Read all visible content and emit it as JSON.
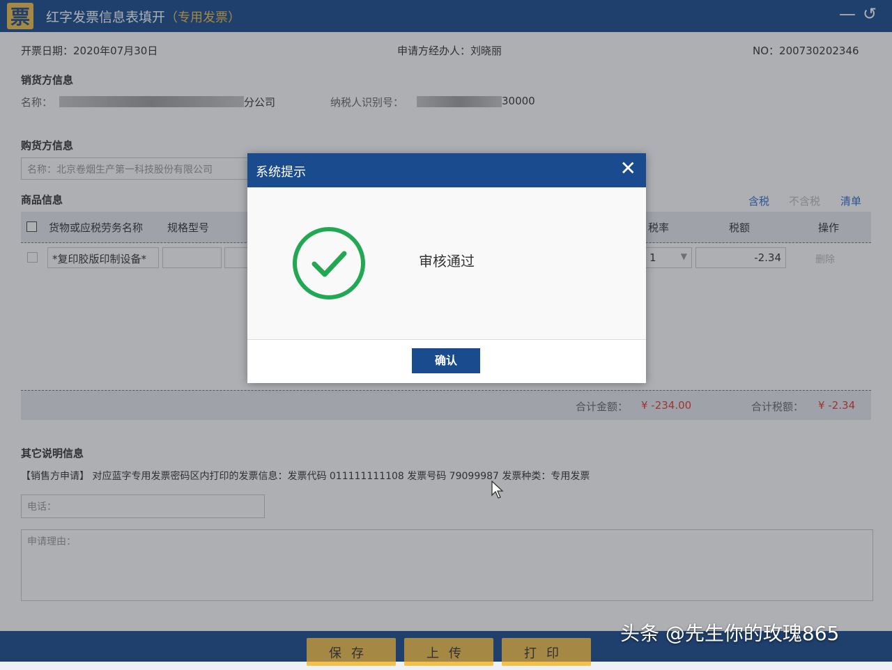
{
  "window": {
    "title": "红字发票信息表填开",
    "subtitle": "（专用发票）",
    "logo_text": "票",
    "minimize_glyph": "—",
    "back_glyph": "↺"
  },
  "header": {
    "date": "开票日期：2020年07月30日",
    "agent": "申请方经办人：刘晓丽",
    "number": "NO：200730202346"
  },
  "seller": {
    "section_title": "销货方信息",
    "name_label": "名称：",
    "name_suffix": "分公司",
    "taxid_label": "纳税人识别号：",
    "taxid_suffix": "30000"
  },
  "buyer": {
    "section_title": "购货方信息",
    "name_value": "名称：北京卷烟生产第一科技股份有限公司"
  },
  "goods": {
    "section_title": "商品信息",
    "links": {
      "tax_inclusive": "含税",
      "tax_exclusive": "不含税",
      "list": "清单"
    },
    "columns": {
      "name": "货物或应税劳务名称",
      "spec": "规格型号",
      "rate": "税率",
      "tax": "税额",
      "action": "操作"
    },
    "row": {
      "name": "*复印胶版印制设备*",
      "rate": "1",
      "tax": "-2.34",
      "action": "删除"
    }
  },
  "summary": {
    "amount_label": "合计金额：",
    "amount_value": "¥ -234.00",
    "tax_label": "合计税额：",
    "tax_value": "¥ -2.34"
  },
  "other": {
    "section_title": "其它说明信息",
    "seller_apply": "【销售方申请】 对应蓝字专用发票密码区内打印的发票信息：发票代码 011111111108 发票号码 79099987 发票种类：专用发票",
    "phone_placeholder": "电话：",
    "reason_placeholder": "申请理由："
  },
  "footer": {
    "save": "保存",
    "upload": "上传",
    "print": "打印"
  },
  "dialog": {
    "title": "系统提示",
    "message": "审核通过",
    "confirm": "确认",
    "close_glyph": "✕",
    "icon": "check-circle-icon",
    "icon_color": "#22a853"
  },
  "watermark": "头条 @先生你的玫瑰865",
  "colors": {
    "titlebar": "#1b4b8f",
    "accent_yellow": "#f3c14b",
    "negative": "#e53935",
    "link": "#2d6fd1"
  }
}
